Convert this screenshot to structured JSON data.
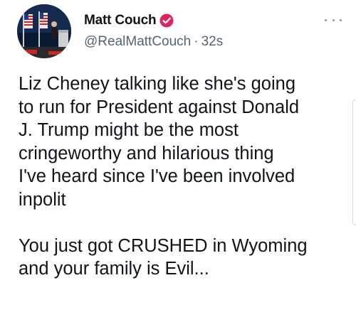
{
  "author": {
    "display_name": "Matt Couch",
    "handle": "@RealMattCouch",
    "separator": "·",
    "timestamp": "32s",
    "verified_icon": "verified-badge-icon",
    "verified_color": "#e0245e"
  },
  "tweet": {
    "text": "Liz Cheney talking like she's going\nto run for President against Donald\nJ. Trump might be the most\ncringeworthy and hilarious thing\nI've heard since I've been involved\ninpolit\n\nYou just got CRUSHED in Wyoming\nand your family is Evil..."
  },
  "icons": {
    "more": "more-options-icon"
  },
  "colors": {
    "text_primary": "#0f1419",
    "text_secondary": "#536471",
    "background": "#ffffff"
  }
}
